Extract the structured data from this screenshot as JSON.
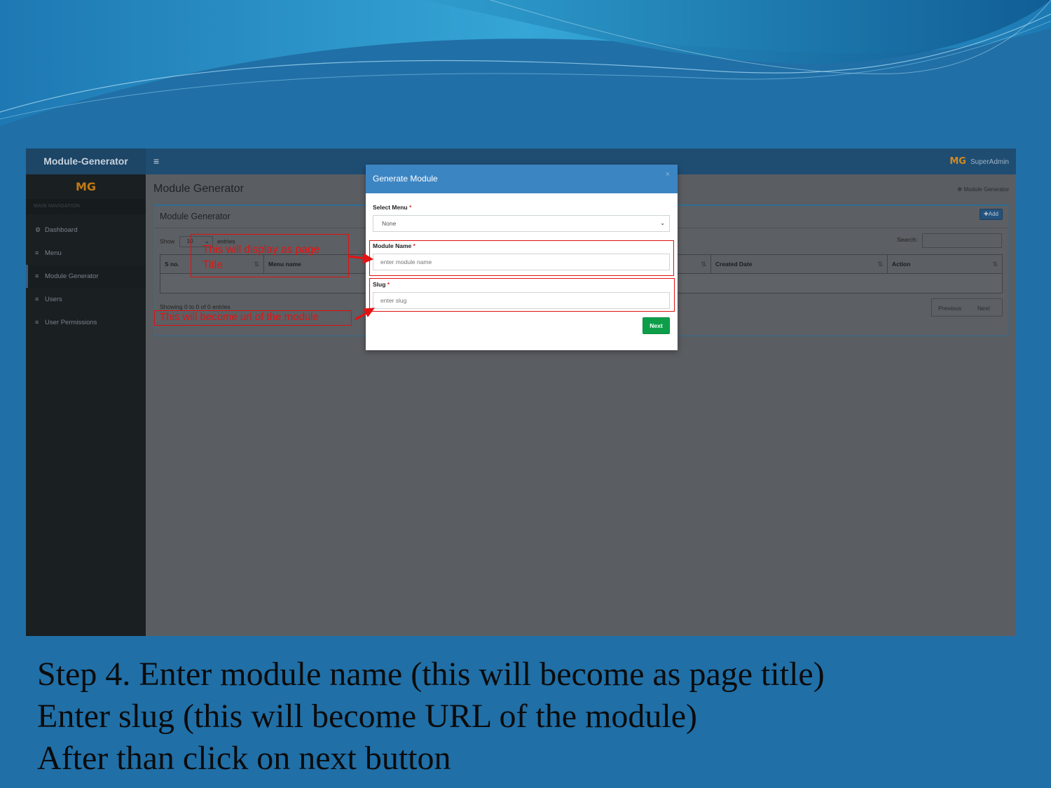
{
  "app": {
    "brand": "Module-Generator",
    "menu_toggle": "≡",
    "user_logo": "MG",
    "user_name": "SuperAdmin"
  },
  "sidebar": {
    "logo": "MG",
    "nav_header": "MAIN NAVIGATION",
    "items": [
      {
        "label": "Dashboard",
        "icon": "dashboard-icon"
      },
      {
        "label": "Menu",
        "icon": "menu-icon"
      },
      {
        "label": "Module Generator",
        "icon": "menu-icon",
        "active": true
      },
      {
        "label": "Users",
        "icon": "menu-icon"
      },
      {
        "label": "User Permissions",
        "icon": "menu-icon"
      }
    ]
  },
  "page": {
    "title": "Module Generator",
    "breadcrumb": "Module Generator",
    "box_title": "Module Generator",
    "add_label": "Add",
    "show_label": "Show",
    "entries_value": "10",
    "entries_label": "entries",
    "search_label": "Search:",
    "columns": [
      "S no.",
      "Menu name",
      "Created Date",
      "Action"
    ],
    "showing": "Showing 0 to 0 of 0 entries",
    "prev": "Previous",
    "next": "Next"
  },
  "modal": {
    "title": "Generate Module",
    "close": "×",
    "select_menu_label": "Select Menu",
    "select_menu_value": "None",
    "module_name_label": "Module Name",
    "module_name_placeholder": "enter module name",
    "slug_label": "Slug",
    "slug_placeholder": "enter slug",
    "required_mark": "*",
    "next_button": "Next"
  },
  "annotations": {
    "title_note_line1": "This will display as page",
    "title_note_line2": "Title",
    "url_note": "This will become url of the module",
    "color": "#e51212"
  },
  "caption": {
    "line1": "Step 4. Enter module name (this will become as page title)",
    "line2": "Enter slug (this will become URL of the module)",
    "line3": "After than click on next button"
  }
}
